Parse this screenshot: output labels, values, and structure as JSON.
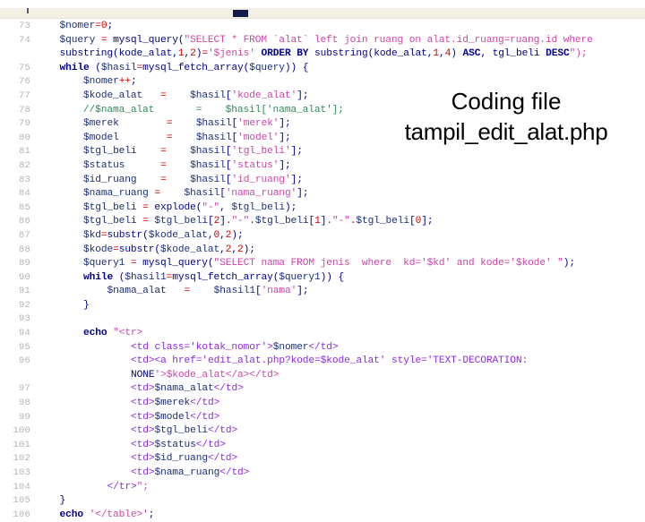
{
  "slide": {
    "background_color": "#ffffff",
    "top_strip_color": "#f2efe4",
    "marker_color": "#151c46"
  },
  "caption": {
    "line1": "Coding file",
    "line2": "tampil_edit_alat.php"
  },
  "code": {
    "language": "php",
    "file": "tampil_edit_alat.php",
    "first_line_number": 73,
    "last_line_number": 106,
    "lines": [
      {
        "no": "73",
        "text": "    $nomer=0;"
      },
      {
        "no": "74",
        "text": "    $query = mysql_query(\"SELECT * FROM `alat` left join ruang on alat.id_ruang=ruang.id where"
      },
      {
        "no": "",
        "text": "    substring(kode_alat,1,2)='$jenis' ORDER BY substring(kode_alat,1,4) ASC, tgl_beli DESC\");"
      },
      {
        "no": "75",
        "text": "    while ($hasil=mysql_fetch_array($query)) {"
      },
      {
        "no": "76",
        "text": "        $nomer++;"
      },
      {
        "no": "77",
        "text": "        $kode_alat   =    $hasil['kode_alat'];"
      },
      {
        "no": "78",
        "text": "        //$nama_alat       =    $hasil['nama_alat'];"
      },
      {
        "no": "79",
        "text": "        $merek        =    $hasil['merek'];"
      },
      {
        "no": "80",
        "text": "        $model        =    $hasil['model'];"
      },
      {
        "no": "81",
        "text": "        $tgl_beli    =    $hasil['tgl_beli'];"
      },
      {
        "no": "82",
        "text": "        $status      =    $hasil['status'];"
      },
      {
        "no": "83",
        "text": "        $id_ruang    =    $hasil['id_ruang'];"
      },
      {
        "no": "84",
        "text": "        $nama_ruang =    $hasil['nama_ruang'];"
      },
      {
        "no": "85",
        "text": "        $tgl_beli = explode(\"-\", $tgl_beli);"
      },
      {
        "no": "86",
        "text": "        $tgl_beli = $tgl_beli[2].\"-\".$tgl_beli[1].\"-\".$tgl_beli[0];"
      },
      {
        "no": "87",
        "text": "        $kd=substr($kode_alat,0,2);"
      },
      {
        "no": "88",
        "text": "        $kode=substr($kode_alat,2,2);"
      },
      {
        "no": "89",
        "text": "        $query1 = mysql_query(\"SELECT nama FROM jenis  where  kd='$kd' and kode='$kode' \");"
      },
      {
        "no": "90",
        "text": "        while ($hasil1=mysql_fetch_array($query1)) {"
      },
      {
        "no": "91",
        "text": "            $nama_alat   =    $hasil1['nama'];"
      },
      {
        "no": "92",
        "text": "        }"
      },
      {
        "no": "93",
        "text": ""
      },
      {
        "no": "94",
        "text": "        echo \"<tr>"
      },
      {
        "no": "95",
        "text": "                <td class='kotak_nomor'>$nomer</td>"
      },
      {
        "no": "96",
        "text": "                <td><a href='edit_alat.php?kode=$kode_alat' style='TEXT-DECORATION:"
      },
      {
        "no": "",
        "text": "                NONE'>$kode_alat</a></td>"
      },
      {
        "no": "97",
        "text": "                <td>$nama_alat</td>"
      },
      {
        "no": "98",
        "text": "                <td>$merek</td>"
      },
      {
        "no": "99",
        "text": "                <td>$model</td>"
      },
      {
        "no": "100",
        "text": "                <td>$tgl_beli</td>"
      },
      {
        "no": "101",
        "text": "                <td>$status</td>"
      },
      {
        "no": "102",
        "text": "                <td>$id_ruang</td>"
      },
      {
        "no": "103",
        "text": "                <td>$nama_ruang</td>"
      },
      {
        "no": "104",
        "text": "            </tr>\";"
      },
      {
        "no": "105",
        "text": "    }"
      },
      {
        "no": "106",
        "text": "    echo '</table>';"
      }
    ]
  }
}
